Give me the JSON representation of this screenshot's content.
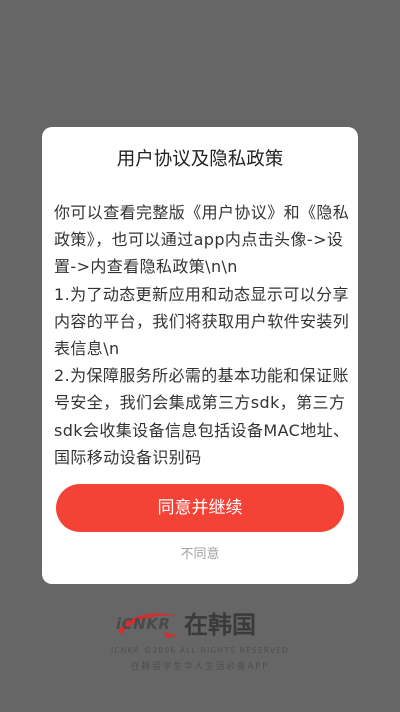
{
  "dialog": {
    "title": "用户协议及隐私政策",
    "paragraphs": [
      "你可以查看完整版《用户协议》和《隐私政策》，也可以通过app内点击头像->设置->内查看隐私政策\\n\\n",
      "1.为了动态更新应用和动态显示可以分享内容的平台，我们将获取用户软件安装列表信息\\n",
      "2.为保障服务所必需的基本功能和保证账号安全，我们会集成第三方sdk，第三方sdk会收集设备信息包括设备MAC地址、国际移动设备识别码"
    ],
    "agree_label": "同意并继续",
    "disagree_label": "不同意"
  },
  "brand": {
    "logo_text": "iCNKR",
    "name": "在韩国",
    "copyright": "ICNKR ©2006 ALL RIGHTS RESERVED",
    "slogan": "在韩留学生华人生活必备APP"
  },
  "colors": {
    "overlay": "#666666",
    "accent": "#f44336",
    "logo_red": "#d03030"
  }
}
